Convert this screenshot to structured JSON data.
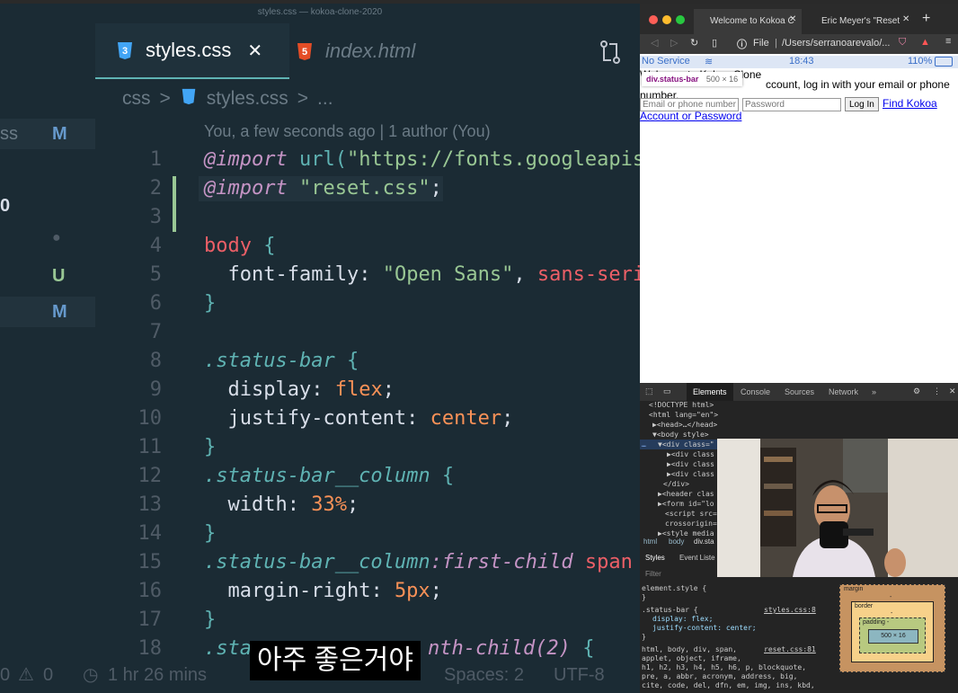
{
  "vscode": {
    "window_title": "styles.css — kokoa-clone-2020",
    "sidebar": [
      {
        "frag": "ss",
        "badge": "M",
        "badge_color": "#6699cc"
      },
      {
        "frag": "0",
        "badge": "",
        "badge_color": ""
      },
      {
        "frag": "",
        "badge": "●",
        "badge_color": "#4f5b66"
      },
      {
        "frag": "",
        "badge": "U",
        "badge_color": "#99c794"
      },
      {
        "frag": "",
        "badge": "M",
        "badge_color": "#6699cc"
      }
    ],
    "tabs": {
      "active": "styles.css",
      "close": "✕",
      "inactive": "index.html"
    },
    "breadcrumb": {
      "folder": "css",
      "sep": ">",
      "file": "styles.css",
      "more": "..."
    },
    "blame": "You, a few seconds ago | 1 author (You)",
    "line_numbers": [
      "1",
      "2",
      "3",
      "4",
      "5",
      "6",
      "7",
      "8",
      "9",
      "10",
      "11",
      "12",
      "13",
      "14",
      "15",
      "16",
      "17",
      "18"
    ],
    "code": {
      "l1_kw": "@import",
      "l1_fn": "url(",
      "l1_str": "\"https://fonts.googleapis",
      "l2_kw": "@import",
      "l2_str": "\"reset.css\"",
      "l2_end": ";",
      "l4_sel": "body",
      "l4_brace": "{",
      "l5_prop": "font-family:",
      "l5_str": "\"Open Sans\"",
      "l5_comma": ",",
      "l5_val": "sans-serif",
      "l6": "}",
      "l8_sel": ".status-bar",
      "l8_brace": "{",
      "l9_prop": "display:",
      "l9_val": "flex",
      "l9_end": ";",
      "l10_prop": "justify-content:",
      "l10_val": "center",
      "l10_end": ";",
      "l11": "}",
      "l12_sel": ".status-bar__column",
      "l12_brace": "{",
      "l13_prop": "width:",
      "l13_val": "33%",
      "l13_end": ";",
      "l14": "}",
      "l15_sel": ".status-bar__column",
      "l15_pcl": ":first-child",
      "l15_tag": "span",
      "l16_prop": "margin-right:",
      "l16_val": "5px",
      "l16_end": ";",
      "l17": "}",
      "l18_sel": ".sta",
      "l18_pcl": "nth-child(2)",
      "l18_brace": "{"
    },
    "status": {
      "problems": "0",
      "warnings": "0",
      "time": "1 hr 26 mins",
      "spaces": "Spaces: 2",
      "encoding": "UTF-8"
    }
  },
  "subtitle": "아주 좋은거야",
  "browser": {
    "tab1": "Welcome to Kokoa C",
    "tab2": "Eric Meyer's \"Reset",
    "new_tab": "+",
    "address_label": "File",
    "address": "/Users/serranoarevalo/...",
    "phone": {
      "carrier": "No Service",
      "time": "18:43",
      "battery": "110%"
    },
    "tooltip": {
      "name": "div.status-bar",
      "size": "500 × 16"
    },
    "welcome": "Welcome to Kokoa Clone",
    "intro_fragment": "ccount, log in with your email or phone number.",
    "email_placeholder": "Email or phone number",
    "password_placeholder": "Password",
    "login_button": "Log In",
    "find_link": "Find Kokoa Account or Password"
  },
  "devtools": {
    "tabs": [
      "Elements",
      "Console",
      "Sources",
      "Network",
      "»"
    ],
    "dom": [
      "<!DOCTYPE html>",
      "<html lang=\"en\">",
      "▶<head>…</head>",
      "▼<body style>",
      "▼<div class=\"",
      "▶<div class",
      "▶<div class",
      "▶<div class",
      "</div>",
      "▶<header clas",
      "▶<form id=\"lo",
      "<script src=",
      "crossorigin=",
      "▶<style media"
    ],
    "crumbs": [
      "html",
      "body",
      "div.sta"
    ],
    "style_tabs": [
      "Styles",
      "Event Liste"
    ],
    "filter": "Filter",
    "rules": [
      "element.style {",
      "}",
      ".status-bar {",
      "display: flex;",
      "justify-content: center;",
      "}",
      "html, body, div, span,",
      "applet, object, iframe,",
      "h1, h2, h3, h4, h5, h6, p, blockquote,",
      "pre, a, abbr, acronym, address, big,",
      "cite, code, del, dfn, em, img, ins, kbd,"
    ],
    "src1": "styles.css:8",
    "src2": "reset.css:81",
    "box": {
      "margin": "margin",
      "border": "border",
      "padding": "padding -",
      "content": "500 × 16",
      "dash": "-"
    }
  }
}
